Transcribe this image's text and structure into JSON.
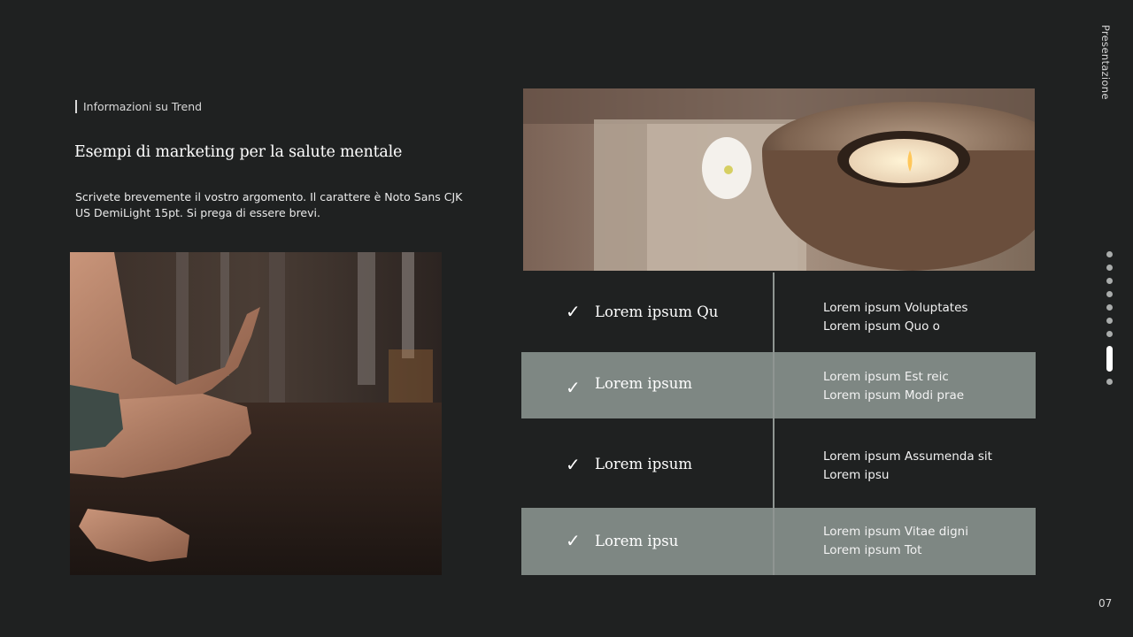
{
  "slide": {
    "section_label": "Informazioni su Trend",
    "title": "Esempi di marketing per la salute mentale",
    "description": "Scrivete brevemente il vostro argomento. Il carattere è Noto Sans CJK US DemiLight 15pt. Si prega di essere brevi.",
    "side_label": "Presentazione",
    "page_number": "07"
  },
  "images": {
    "meditation": "meditation-hands-photo",
    "candle": "candle-on-wood-photo"
  },
  "table": {
    "rows": [
      {
        "check": "✓",
        "title": "Lorem ipsum Qu",
        "desc_line1": "Lorem ipsum Voluptates",
        "desc_line2": "Lorem ipsum Quo o",
        "shaded": false
      },
      {
        "check": "✓",
        "title": "Lorem ipsum",
        "desc_line1": "Lorem ipsum Est reic",
        "desc_line2": "Lorem ipsum Modi prae",
        "shaded": true
      },
      {
        "check": "✓",
        "title": "Lorem ipsum",
        "desc_line1": "Lorem ipsum Assumenda sit",
        "desc_line2": "Lorem ipsu",
        "shaded": false
      },
      {
        "check": "✓",
        "title": "Lorem ipsu",
        "desc_line1": "Lorem ipsum Vitae digni",
        "desc_line2": "Lorem ipsum Tot",
        "shaded": true
      }
    ]
  },
  "navigation": {
    "total": 10,
    "active_index": 8
  },
  "colors": {
    "background": "#1f2121",
    "shaded_row": "#7e8783",
    "text": "#ffffff"
  }
}
